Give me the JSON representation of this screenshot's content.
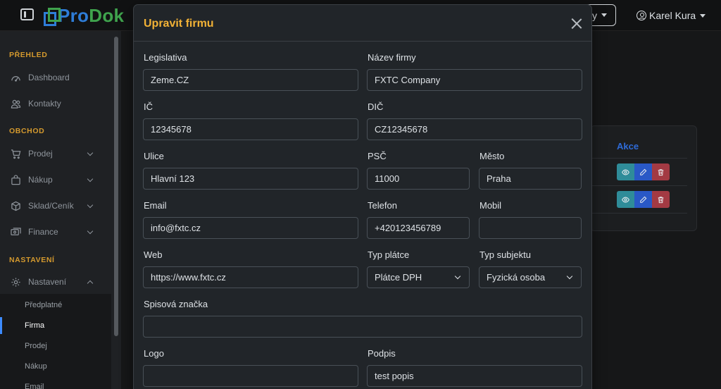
{
  "navbar": {
    "logo_part1": "Pro",
    "logo_part2": "Dok",
    "company_select_fragment": "y",
    "user_name": "Karel Kura"
  },
  "sidebar": {
    "section_overview": "PŘEHLED",
    "dashboard": "Dashboard",
    "contacts": "Kontakty",
    "section_trade": "OBCHOD",
    "sales": "Prodej",
    "purchase": "Nákup",
    "stock": "Sklad/Ceník",
    "finance": "Finance",
    "section_settings": "NASTAVENÍ",
    "settings": "Nastavení",
    "sub_items": [
      "Předplatné",
      "Firma",
      "Prodej",
      "Nákup",
      "Email"
    ],
    "active_sub": "Firma"
  },
  "background": {
    "actions_header": "Akce"
  },
  "modal": {
    "title": "Upravit firmu",
    "fields": {
      "legislation": {
        "label": "Legislativa",
        "value": "Zeme.CZ"
      },
      "company_name": {
        "label": "Název firmy",
        "value": "FXTC Company"
      },
      "ic": {
        "label": "IČ",
        "value": "12345678"
      },
      "dic": {
        "label": "DIČ",
        "value": "CZ12345678"
      },
      "street": {
        "label": "Ulice",
        "value": "Hlavní 123"
      },
      "zip": {
        "label": "PSČ",
        "value": "11000"
      },
      "city": {
        "label": "Město",
        "value": "Praha"
      },
      "email": {
        "label": "Email",
        "value": "info@fxtc.cz"
      },
      "phone": {
        "label": "Telefon",
        "value": "+420123456789"
      },
      "mobile": {
        "label": "Mobil",
        "value": ""
      },
      "web": {
        "label": "Web",
        "value": "https://www.fxtc.cz"
      },
      "payer_type": {
        "label": "Typ plátce",
        "value": "Plátce DPH"
      },
      "subject_type": {
        "label": "Typ subjektu",
        "value": "Fyzická osoba"
      },
      "file_mark": {
        "label": "Spisová značka",
        "value": ""
      },
      "logo": {
        "label": "Logo",
        "value": ""
      },
      "signature": {
        "label": "Podpis",
        "value": "test popis"
      }
    }
  },
  "colors": {
    "accent": "#f2b236",
    "section_title": "#d59a2e",
    "logo_blue": "#2e7dd8",
    "logo_green": "#3fa34d"
  }
}
